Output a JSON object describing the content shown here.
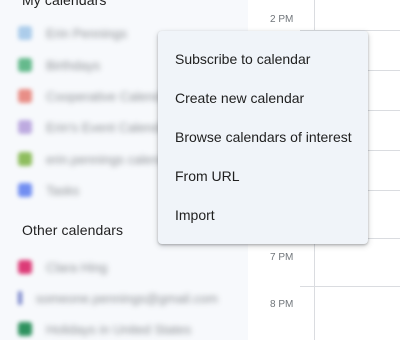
{
  "sidebar": {
    "my_calendars": {
      "title": "My calendars",
      "items": [
        {
          "label": "Erin Pennings",
          "color": "#9fc5e8"
        },
        {
          "label": "Birthdays",
          "color": "#4caf79"
        },
        {
          "label": "Cooperative Calendar",
          "color": "#e67c73"
        },
        {
          "label": "Erin's Event Calendar",
          "color": "#b39ddb"
        },
        {
          "label": "erin.pennings calendar",
          "color": "#7cb342"
        },
        {
          "label": "Tasks",
          "color": "#5b7cf0"
        }
      ]
    },
    "other_calendars": {
      "title": "Other calendars",
      "items": [
        {
          "label": "Clara Hing",
          "color": "#d81b60"
        },
        {
          "label": "someone.pennings@gmail.com",
          "color": "#5c6bc0"
        },
        {
          "label": "Holidays in United States",
          "color": "#0b8043"
        }
      ]
    }
  },
  "timeline": {
    "labels": [
      "2 PM",
      "7 PM",
      "8 PM"
    ]
  },
  "menu": {
    "items": [
      {
        "label": "Subscribe to calendar"
      },
      {
        "label": "Create new calendar"
      },
      {
        "label": "Browse calendars of interest"
      },
      {
        "label": "From URL"
      },
      {
        "label": "Import"
      }
    ]
  }
}
